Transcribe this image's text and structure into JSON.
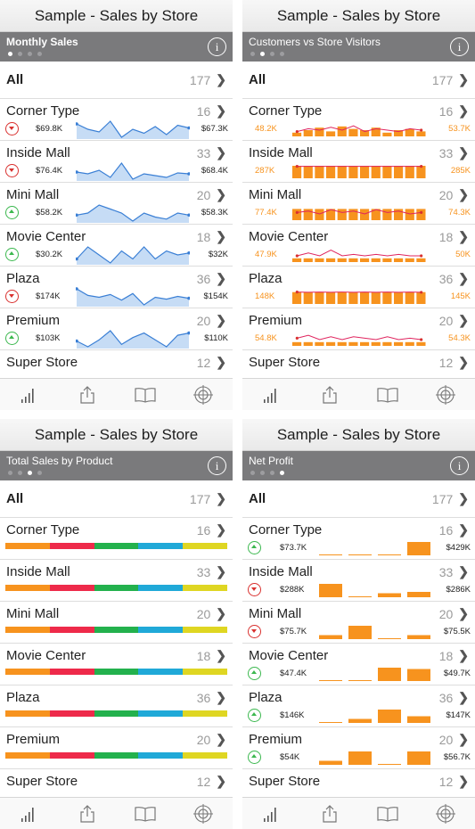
{
  "app_title": "Sample - Sales by Store",
  "colors": {
    "line": "#3a7fd5",
    "area": "#b8d3f2",
    "bar": "#f7931e",
    "down": "#d9312f",
    "up": "#3cb84f"
  },
  "tab_icons": [
    "bar-chart-icon",
    "share-icon",
    "book-icon",
    "target-icon"
  ],
  "screens": [
    {
      "subtitle": "Monthly Sales",
      "all": {
        "label": "All",
        "count": "177"
      },
      "rows": [
        {
          "name": "Corner Type",
          "count": "16",
          "trend": "down",
          "left": "$69.8K",
          "right": "$67.3K",
          "spark": [
            70,
            66,
            64,
            72,
            60,
            66,
            63,
            68,
            62,
            69,
            67
          ]
        },
        {
          "name": "Inside Mall",
          "count": "33",
          "trend": "down",
          "left": "$76.4K",
          "right": "$68.4K",
          "spark": [
            70,
            68,
            72,
            64,
            80,
            62,
            68,
            66,
            64,
            69,
            68
          ]
        },
        {
          "name": "Mini Mall",
          "count": "20",
          "trend": "up",
          "left": "$58.2K",
          "right": "$58.3K",
          "spark": [
            58,
            60,
            68,
            64,
            60,
            52,
            60,
            56,
            54,
            60,
            58
          ]
        },
        {
          "name": "Movie Center",
          "count": "18",
          "trend": "up",
          "left": "$30.2K",
          "right": "$32K",
          "spark": [
            30,
            36,
            32,
            28,
            34,
            30,
            36,
            30,
            34,
            32,
            33
          ]
        },
        {
          "name": "Plaza",
          "count": "36",
          "trend": "down",
          "left": "$174K",
          "right": "$154K",
          "spark": [
            174,
            160,
            156,
            162,
            150,
            164,
            140,
            156,
            152,
            158,
            154
          ]
        },
        {
          "name": "Premium",
          "count": "20",
          "trend": "up",
          "left": "$103K",
          "right": "$110K",
          "spark": [
            103,
            98,
            104,
            112,
            100,
            106,
            110,
            104,
            98,
            108,
            110
          ]
        },
        {
          "name": "Super Store",
          "count": "12"
        }
      ]
    },
    {
      "subtitle": "Customers vs Store Visitors",
      "all": {
        "label": "All",
        "count": "177"
      },
      "rows": [
        {
          "name": "Corner Type",
          "count": "16",
          "left": "48.2K",
          "right": "53.7K",
          "bars": [
            0.3,
            0.5,
            0.7,
            0.4,
            0.8,
            0.6,
            0.5,
            0.7,
            0.3,
            0.5,
            0.6,
            0.4
          ],
          "line": [
            0.4,
            0.6,
            0.5,
            0.7,
            0.5,
            0.8,
            0.4,
            0.6,
            0.5,
            0.4,
            0.6,
            0.5
          ]
        },
        {
          "name": "Inside Mall",
          "count": "33",
          "left": "287K",
          "right": "285K",
          "bars": [
            1,
            1,
            1,
            1,
            1,
            1,
            1,
            1,
            1,
            1,
            1,
            1
          ],
          "line": [
            0.9,
            0.9,
            0.9,
            0.9,
            0.9,
            0.9,
            0.9,
            0.9,
            0.9,
            0.9,
            0.9,
            0.9
          ]
        },
        {
          "name": "Mini Mall",
          "count": "20",
          "left": "77.4K",
          "right": "74.3K",
          "bars": [
            0.9,
            0.9,
            0.9,
            0.9,
            0.9,
            0.9,
            0.9,
            0.9,
            0.9,
            0.9,
            0.9,
            0.9
          ],
          "line": [
            0.6,
            0.7,
            0.5,
            0.8,
            0.6,
            0.7,
            0.5,
            0.8,
            0.6,
            0.7,
            0.5,
            0.6
          ]
        },
        {
          "name": "Movie Center",
          "count": "18",
          "left": "47.9K",
          "right": "50K",
          "bars": [
            0.3,
            0.3,
            0.3,
            0.3,
            0.3,
            0.3,
            0.3,
            0.3,
            0.3,
            0.3,
            0.3,
            0.3
          ],
          "line": [
            0.5,
            0.7,
            0.5,
            0.9,
            0.5,
            0.6,
            0.5,
            0.6,
            0.5,
            0.6,
            0.5,
            0.5
          ]
        },
        {
          "name": "Plaza",
          "count": "36",
          "left": "148K",
          "right": "145K",
          "bars": [
            0.95,
            0.95,
            0.95,
            0.95,
            0.95,
            0.95,
            0.95,
            0.95,
            0.95,
            0.95,
            0.95,
            0.95
          ],
          "line": [
            0.9,
            0.88,
            0.9,
            0.88,
            0.9,
            0.88,
            0.9,
            0.88,
            0.9,
            0.88,
            0.9,
            0.88
          ]
        },
        {
          "name": "Premium",
          "count": "20",
          "left": "54.8K",
          "right": "54.3K",
          "bars": [
            0.3,
            0.3,
            0.3,
            0.3,
            0.3,
            0.3,
            0.3,
            0.3,
            0.3,
            0.3,
            0.3,
            0.3
          ],
          "line": [
            0.6,
            0.8,
            0.5,
            0.7,
            0.5,
            0.7,
            0.6,
            0.5,
            0.7,
            0.5,
            0.6,
            0.5
          ]
        },
        {
          "name": "Super Store",
          "count": "12"
        }
      ]
    },
    {
      "subtitle": "Total Sales by Product",
      "all": {
        "label": "All",
        "count": "177"
      },
      "stack_colors": [
        "#f7931e",
        "#ee2a4a",
        "#23b14d",
        "#20a9d8",
        "#dfd622"
      ],
      "stack_shares": [
        0.2,
        0.2,
        0.2,
        0.2,
        0.2
      ],
      "rows": [
        {
          "name": "Corner Type",
          "count": "16"
        },
        {
          "name": "Inside Mall",
          "count": "33"
        },
        {
          "name": "Mini Mall",
          "count": "20"
        },
        {
          "name": "Movie Center",
          "count": "18"
        },
        {
          "name": "Plaza",
          "count": "36"
        },
        {
          "name": "Premium",
          "count": "20"
        },
        {
          "name": "Super Store",
          "count": "12"
        }
      ]
    },
    {
      "subtitle": "Net Profit",
      "all": {
        "label": "All",
        "count": "177"
      },
      "rows": [
        {
          "name": "Corner Type",
          "count": "16",
          "trend": "up",
          "left": "$73.7K",
          "right": "$429K",
          "levels": [
            0.02,
            0.02,
            0.02,
            1
          ]
        },
        {
          "name": "Inside Mall",
          "count": "33",
          "trend": "down",
          "left": "$288K",
          "right": "$286K",
          "levels": [
            1,
            0.05,
            0.3,
            0.4
          ]
        },
        {
          "name": "Mini Mall",
          "count": "20",
          "trend": "down",
          "left": "$75.7K",
          "right": "$75.5K",
          "levels": [
            0.3,
            1,
            0.05,
            0.3
          ]
        },
        {
          "name": "Movie Center",
          "count": "18",
          "trend": "up",
          "left": "$47.4K",
          "right": "$49.7K",
          "levels": [
            0.02,
            0.02,
            1,
            0.9
          ]
        },
        {
          "name": "Plaza",
          "count": "36",
          "trend": "up",
          "left": "$146K",
          "right": "$147K",
          "levels": [
            0.05,
            0.3,
            1,
            0.5
          ]
        },
        {
          "name": "Premium",
          "count": "20",
          "trend": "up",
          "left": "$54K",
          "right": "$56.7K",
          "levels": [
            0.3,
            1,
            0.02,
            1
          ]
        },
        {
          "name": "Super Store",
          "count": "12"
        }
      ]
    }
  ]
}
